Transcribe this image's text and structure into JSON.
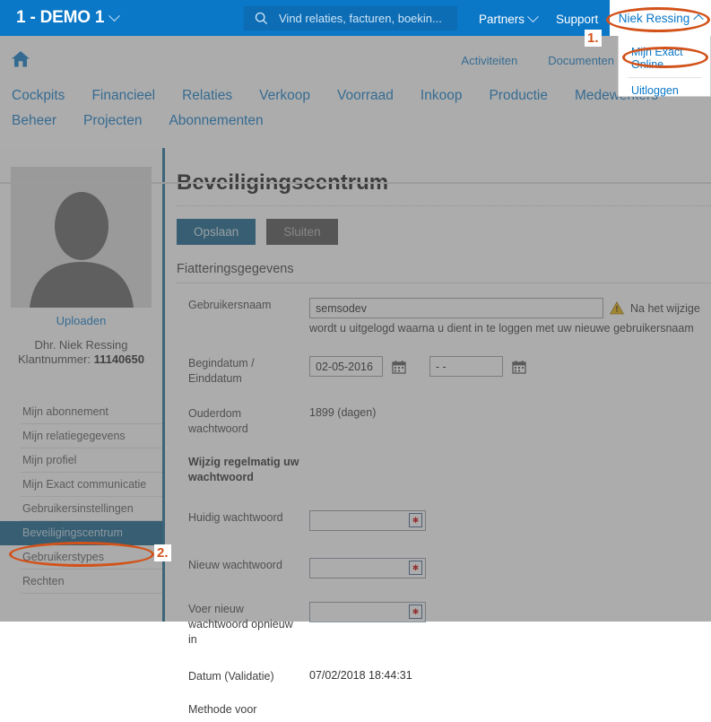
{
  "topbar": {
    "company": "1 - DEMO 1",
    "company_caret": "chevron-down-icon",
    "search": {
      "icon": "search-icon",
      "placeholder": "Vind relaties, facturen, boekin...",
      "value": ""
    },
    "partners": "Partners",
    "support": "Support",
    "user": "Niek Ressing",
    "user_caret": "chevron-up-icon"
  },
  "user_dropdown": {
    "items": [
      {
        "label": "Mijn Exact Online"
      },
      {
        "label": "Uitloggen"
      }
    ]
  },
  "navbar": {
    "home_icon": "home-icon",
    "secondary": [
      {
        "label": "Activiteiten"
      },
      {
        "label": "Documenten"
      }
    ],
    "main": [
      {
        "label": "Cockpits"
      },
      {
        "label": "Financieel"
      },
      {
        "label": "Relaties"
      },
      {
        "label": "Verkoop"
      },
      {
        "label": "Voorraad"
      },
      {
        "label": "Inkoop"
      },
      {
        "label": "Productie"
      },
      {
        "label": "Medewerkers"
      },
      {
        "label": "Beheer"
      },
      {
        "label": "Projecten"
      },
      {
        "label": "Abonnementen"
      }
    ]
  },
  "sidebar": {
    "avatar": "user-avatar-placeholder",
    "upload_link": "Uploaden",
    "user_name": "Dhr. Niek Ressing",
    "customer_label": "Klantnummer:",
    "customer_number": "11140650",
    "items": [
      {
        "label": "Mijn abonnement",
        "active": false
      },
      {
        "label": "Mijn relatiegegevens",
        "active": false
      },
      {
        "label": "Mijn profiel",
        "active": false
      },
      {
        "label": "Mijn Exact communicatie",
        "active": false
      },
      {
        "label": "Gebruikersinstellingen",
        "active": false
      },
      {
        "label": "Beveiligingscentrum",
        "active": true
      },
      {
        "label": "Gebruikerstypes",
        "active": false
      },
      {
        "label": "Rechten",
        "active": false
      }
    ]
  },
  "main": {
    "title": "Beveiligingscentrum",
    "save_label": "Opslaan",
    "close_label": "Sluiten",
    "section_title": "Fiatteringsgegevens",
    "fields": {
      "username_label": "Gebruikersnaam",
      "username_value": "semsodev",
      "warning_icon": "warning-triangle-icon",
      "warning_text": "Na het wijzige",
      "warning_text_2": "wordt u uitgelogd waarna u dient in te loggen met uw nieuwe gebruikersnaam",
      "dates_label": "Begindatum / Einddatum",
      "start_date": "02-05-2016",
      "end_date": "- -",
      "calendar_icon": "calendar-icon",
      "age_label": "Ouderdom wachtwoord",
      "age_value": "1899 (dagen)",
      "change_regularly_label": "Wijzig regelmatig uw wachtwoord",
      "current_pw_label": "Huidig wachtwoord",
      "current_pw_value": "",
      "new_pw_label": "Nieuw wachtwoord",
      "new_pw_value": "",
      "repeat_pw_label": "Voer nieuw wachtwoord opnieuw in",
      "repeat_pw_value": "",
      "required_badge": "required-asterisk-icon",
      "validation_date_label": "Datum (Validatie)",
      "validation_date_value": "07/02/2018 18:44:31",
      "method_label": "Methode voor"
    }
  },
  "annotations": {
    "step1": "1.",
    "step2": "2."
  },
  "colors": {
    "brand_blue": "#0a77c7",
    "dark_blue": "#0b5c86",
    "annotation_orange": "#d2521a",
    "warning_yellow": "#e8b000"
  }
}
